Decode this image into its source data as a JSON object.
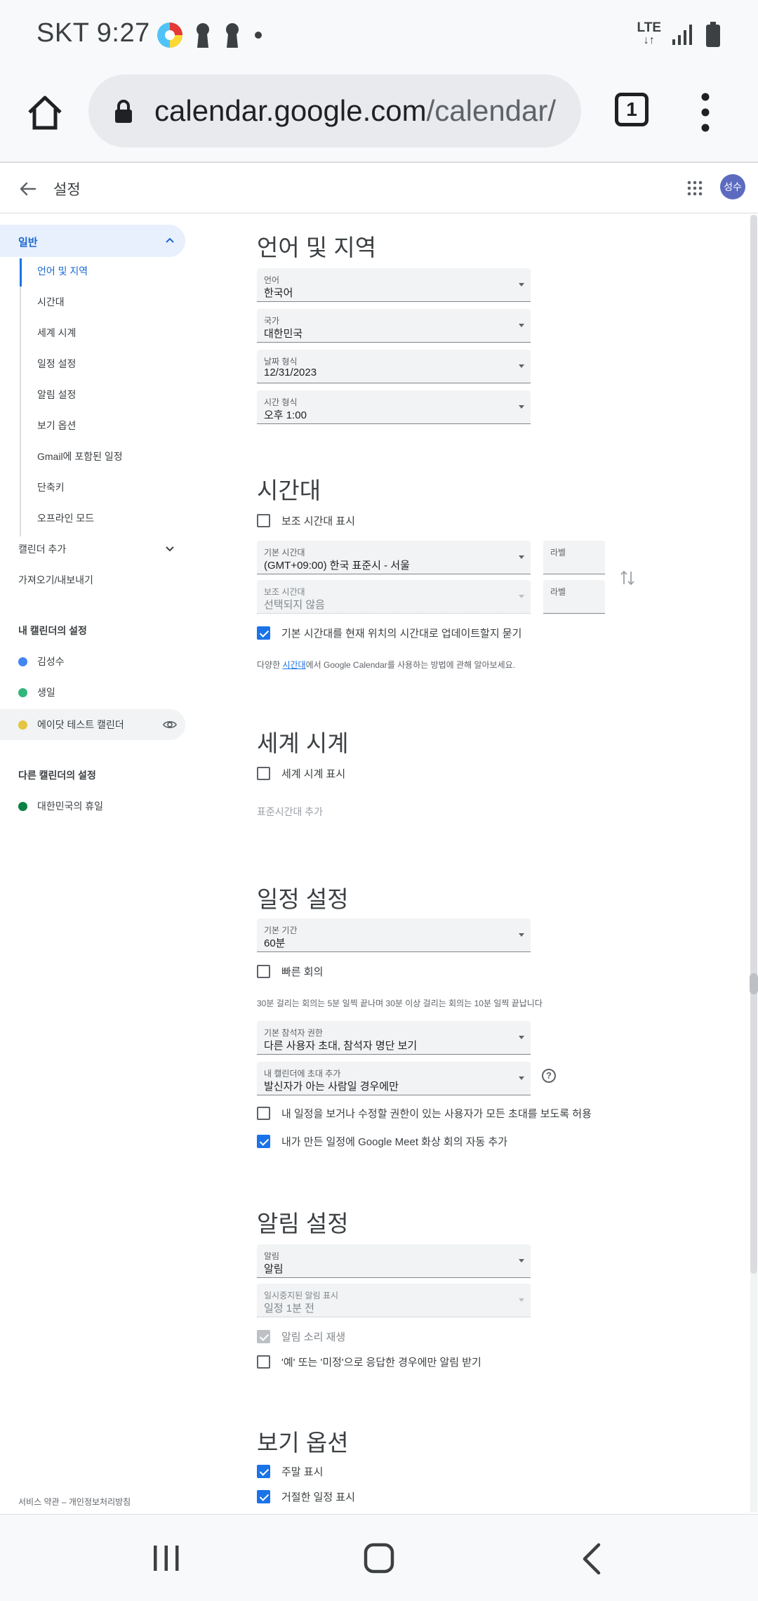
{
  "status_bar": {
    "carrier_time": "SKT 9:27",
    "network": "LTE"
  },
  "browser": {
    "url_main": "calendar.google.com",
    "url_path": "/calendar/",
    "tab_count": "1"
  },
  "header": {
    "title": "설정",
    "avatar_label": "성수"
  },
  "sidebar": {
    "general": "일반",
    "sub_items": [
      "언어 및 지역",
      "시간대",
      "세계 시계",
      "일정 설정",
      "알림 설정",
      "보기 옵션",
      "Gmail에 포함된 일정",
      "단축키",
      "오프라인 모드"
    ],
    "add_calendar": "캘린더 추가",
    "import_export": "가져오기/내보내기",
    "my_calendars_heading": "내 캘린더의 설정",
    "my_calendars": [
      {
        "name": "김성수",
        "color": "#4285f4"
      },
      {
        "name": "생일",
        "color": "#33b679"
      },
      {
        "name": "에이닷 테스트 캘린더",
        "color": "#e4c441"
      }
    ],
    "other_calendars_heading": "다른 캘린더의 설정",
    "other_calendars": [
      {
        "name": "대한민국의 휴일",
        "color": "#0b8043"
      }
    ],
    "footer": "서비스 약관 – 개인정보처리방침"
  },
  "language_region": {
    "title": "언어 및 지역",
    "language": {
      "label": "언어",
      "value": "한국어"
    },
    "country": {
      "label": "국가",
      "value": "대한민국"
    },
    "date_format": {
      "label": "날짜 형식",
      "value": "12/31/2023"
    },
    "time_format": {
      "label": "시간 형식",
      "value": "오후 1:00"
    }
  },
  "timezone": {
    "title": "시간대",
    "show_secondary": "보조 시간대 표시",
    "primary": {
      "label": "기본 시간대",
      "value": "(GMT+09:00) 한국 표준시 - 서울",
      "tag_label": "라벨"
    },
    "secondary": {
      "label": "보조 시간대",
      "value": "선택되지 않음",
      "tag_label": "라벨"
    },
    "ask_update": "기본 시간대를 현재 위치의 시간대로 업데이트할지 묻기",
    "note_prefix": "다양한 ",
    "note_link": "시간대",
    "note_suffix": "에서 Google Calendar를 사용하는 방법에 관해 알아보세요."
  },
  "world_clock": {
    "title": "세계 시계",
    "show": "세계 시계 표시",
    "add": "표준시간대 추가"
  },
  "event_settings": {
    "title": "일정 설정",
    "duration": {
      "label": "기본 기간",
      "value": "60분"
    },
    "speedy_meetings": "빠른 회의",
    "speedy_note": "30분 걸리는 회의는 5분 일찍 끝나며 30분 이상 걸리는 회의는 10분 일찍 끝납니다",
    "guest_permissions": {
      "label": "기본 참석자 권한",
      "value": "다른 사용자 초대, 참석자 명단 보기"
    },
    "add_invitations": {
      "label": "내 캘린더에 초대 추가",
      "value": "발신자가 아는 사람일 경우에만"
    },
    "help": "?",
    "allow_see_invites": "내 일정을 보거나 수정할 권한이 있는 사용자가 모든 초대를 보도록 허용",
    "auto_meet": "내가 만든 일정에 Google Meet 화상 회의 자동 추가"
  },
  "notification_settings": {
    "title": "알림 설정",
    "notifications": {
      "label": "알림",
      "value": "알림"
    },
    "snoozed": {
      "label": "일시중지된 알림 표시",
      "value": "일정 1분 전"
    },
    "play_sound": "알림 소리 재생",
    "only_if_yes": "'예' 또는 '미정'으로 응답한 경우에만 알림 받기"
  },
  "view_options": {
    "title": "보기 옵션",
    "show_weekends": "주말 표시",
    "show_declined": "거절한 일정 표시"
  }
}
